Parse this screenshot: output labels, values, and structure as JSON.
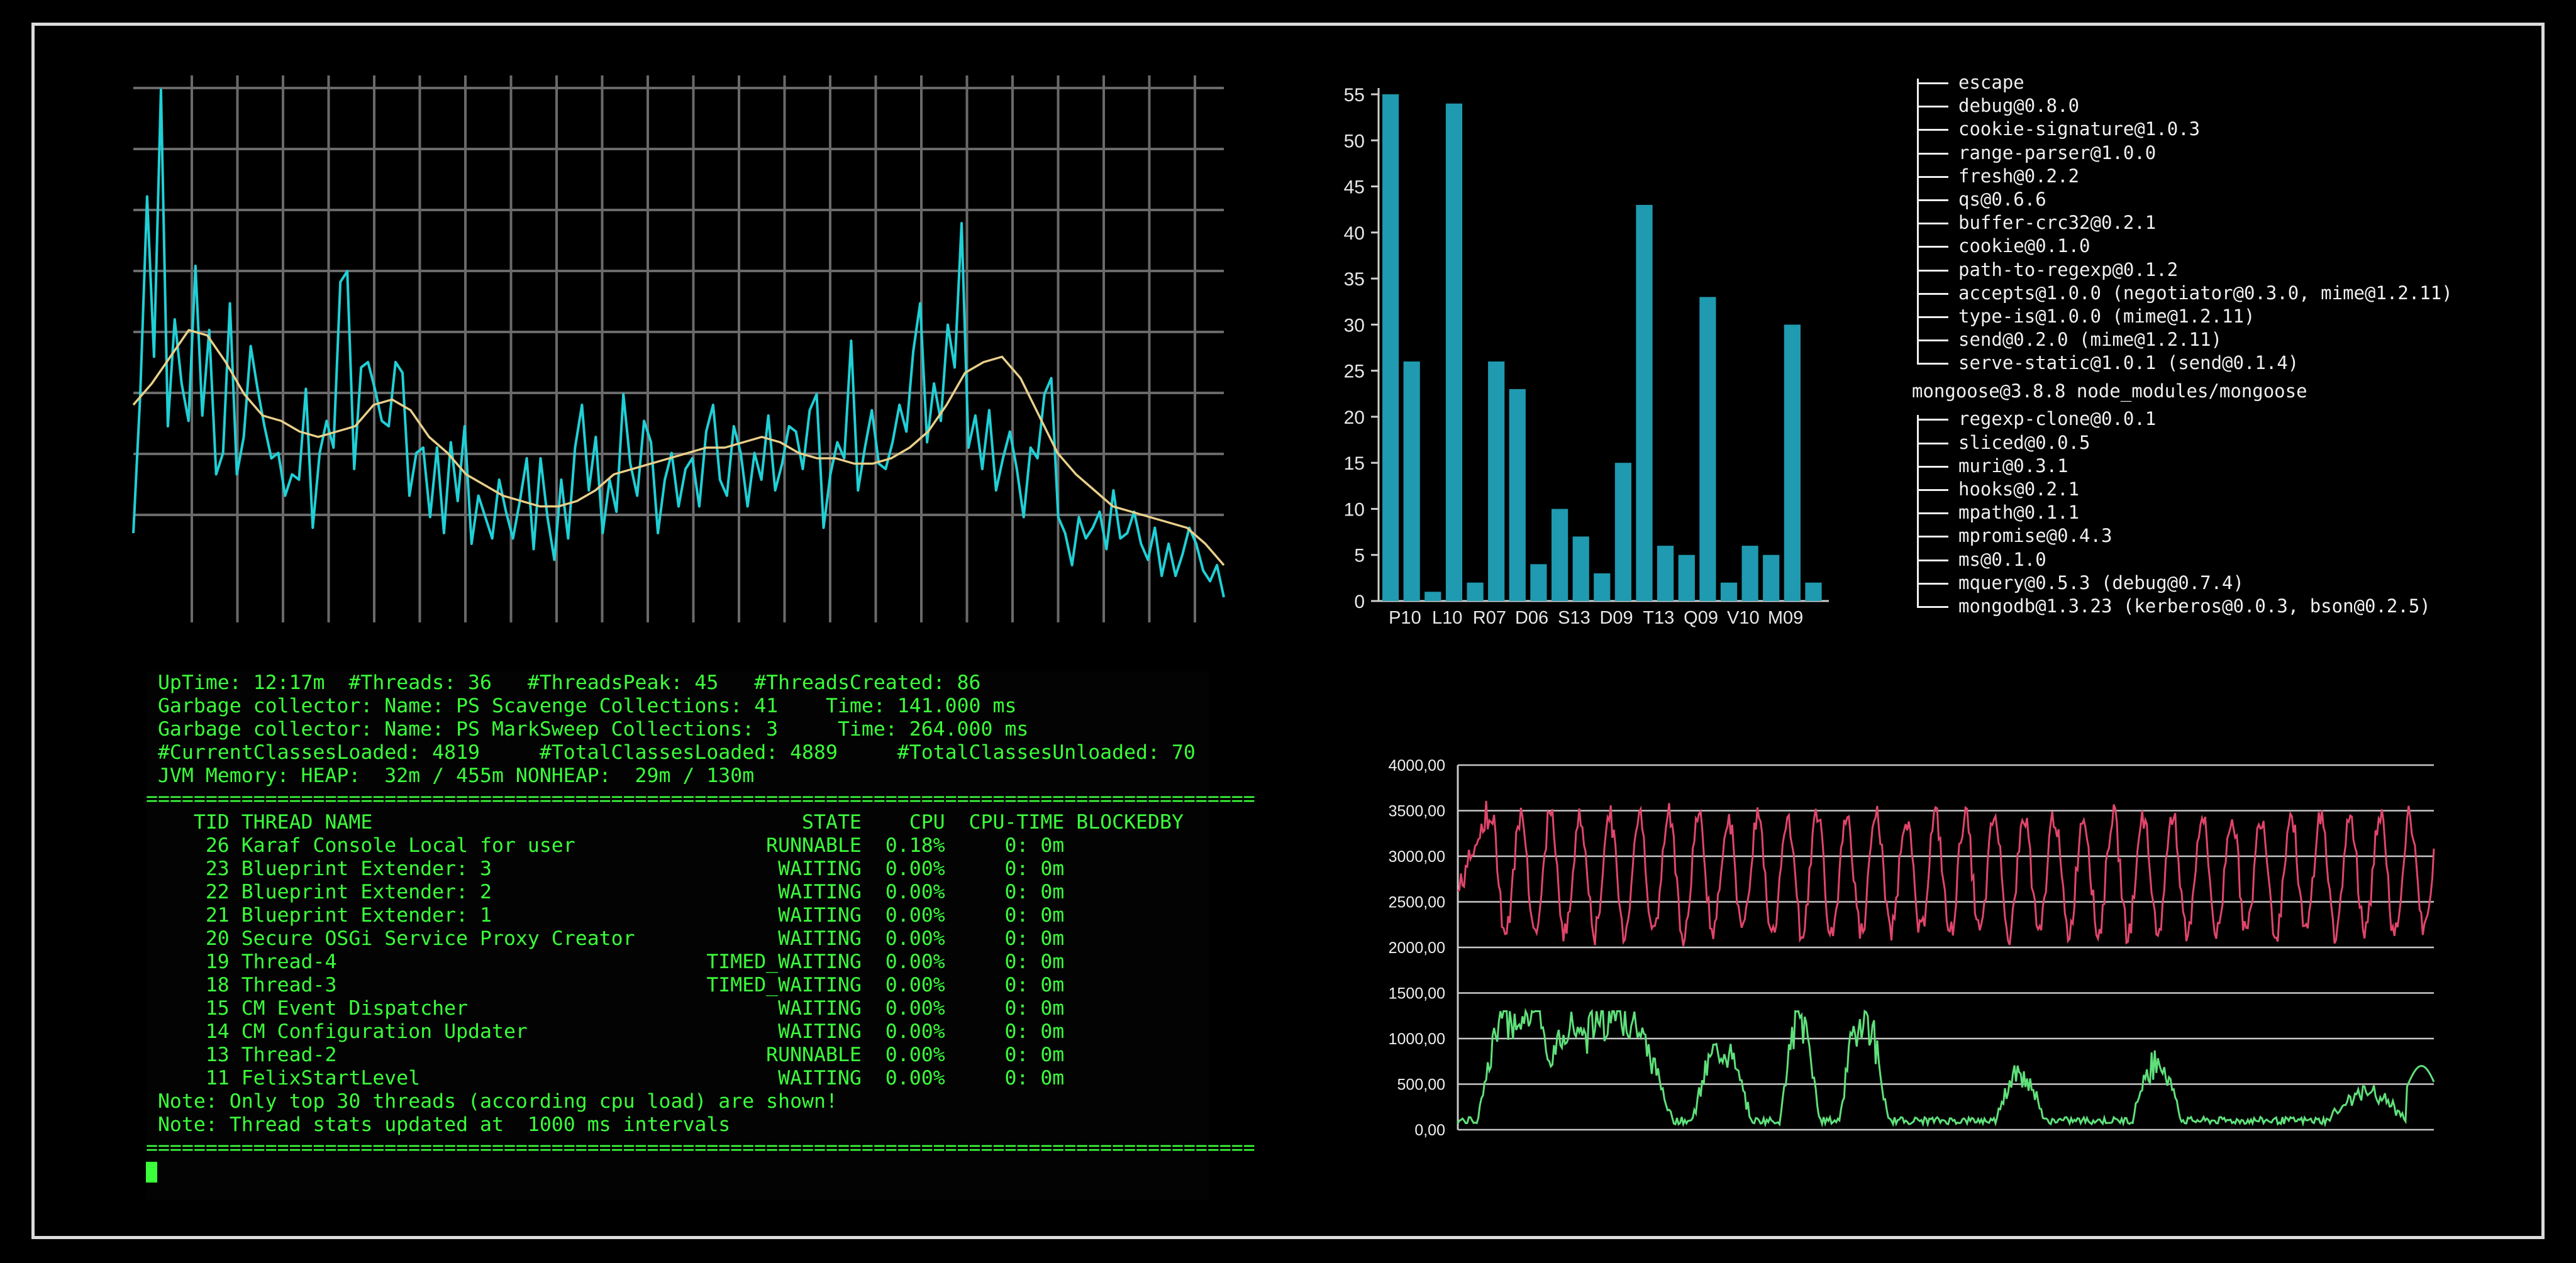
{
  "line_chart": {
    "colors": {
      "raw": "#1fd0d6",
      "smooth": "#e8cf8a",
      "grid": "#6a6a6a"
    },
    "raw": [
      0.12,
      0.38,
      0.75,
      0.45,
      0.95,
      0.32,
      0.52,
      0.4,
      0.33,
      0.62,
      0.34,
      0.5,
      0.23,
      0.27,
      0.55,
      0.23,
      0.3,
      0.47,
      0.39,
      0.32,
      0.26,
      0.27,
      0.19,
      0.23,
      0.22,
      0.39,
      0.13,
      0.27,
      0.33,
      0.28,
      0.59,
      0.61,
      0.24,
      0.43,
      0.44,
      0.39,
      0.33,
      0.32,
      0.44,
      0.42,
      0.19,
      0.27,
      0.28,
      0.15,
      0.28,
      0.12,
      0.29,
      0.18,
      0.32,
      0.1,
      0.19,
      0.15,
      0.11,
      0.22,
      0.16,
      0.11,
      0.18,
      0.26,
      0.09,
      0.26,
      0.15,
      0.07,
      0.22,
      0.11,
      0.28,
      0.36,
      0.2,
      0.3,
      0.12,
      0.22,
      0.16,
      0.38,
      0.25,
      0.19,
      0.33,
      0.29,
      0.12,
      0.22,
      0.27,
      0.17,
      0.24,
      0.26,
      0.17,
      0.31,
      0.36,
      0.22,
      0.19,
      0.32,
      0.27,
      0.17,
      0.27,
      0.22,
      0.34,
      0.2,
      0.25,
      0.32,
      0.31,
      0.24,
      0.35,
      0.38,
      0.13,
      0.23,
      0.29,
      0.26,
      0.48,
      0.2,
      0.28,
      0.35,
      0.25,
      0.24,
      0.29,
      0.36,
      0.31,
      0.46,
      0.55,
      0.29,
      0.4,
      0.33,
      0.51,
      0.43,
      0.7,
      0.28,
      0.34,
      0.24,
      0.35,
      0.2,
      0.26,
      0.31,
      0.24,
      0.15,
      0.28,
      0.26,
      0.38,
      0.41,
      0.15,
      0.12,
      0.06,
      0.15,
      0.11,
      0.13,
      0.16,
      0.09,
      0.2,
      0.11,
      0.12,
      0.16,
      0.1,
      0.07,
      0.13,
      0.04,
      0.1,
      0.04,
      0.08,
      0.13,
      0.1,
      0.05,
      0.03,
      0.06,
      0.0
    ],
    "smooth": [
      0.36,
      0.4,
      0.45,
      0.5,
      0.49,
      0.44,
      0.38,
      0.34,
      0.33,
      0.31,
      0.3,
      0.31,
      0.32,
      0.36,
      0.37,
      0.35,
      0.3,
      0.27,
      0.23,
      0.21,
      0.19,
      0.18,
      0.17,
      0.17,
      0.18,
      0.2,
      0.23,
      0.24,
      0.25,
      0.26,
      0.27,
      0.28,
      0.28,
      0.29,
      0.3,
      0.29,
      0.27,
      0.26,
      0.26,
      0.25,
      0.25,
      0.26,
      0.28,
      0.31,
      0.36,
      0.42,
      0.44,
      0.45,
      0.41,
      0.34,
      0.27,
      0.23,
      0.2,
      0.17,
      0.16,
      0.15,
      0.14,
      0.13,
      0.1,
      0.06
    ]
  },
  "bar_chart": {
    "color": "#1f9ab0",
    "axis_color": "#cfcfcf",
    "y_ticks": [
      "55",
      "50",
      "45",
      "40",
      "35",
      "30",
      "25",
      "20",
      "15",
      "10",
      "5",
      "0"
    ],
    "x_labels": [
      "P10",
      "L10",
      "R07",
      "D06",
      "S13",
      "D09",
      "T13",
      "Q09",
      "V10",
      "M09"
    ],
    "values": [
      55,
      26,
      1,
      54,
      2,
      26,
      23,
      4,
      10,
      7,
      3,
      15,
      43,
      6,
      5,
      33,
      2,
      6,
      5,
      30,
      2
    ]
  },
  "tree": {
    "group1": [
      "escape",
      "debug@0.8.0",
      "cookie-signature@1.0.3",
      "range-parser@1.0.0",
      "fresh@0.2.2",
      "qs@0.6.6",
      "buffer-crc32@0.2.1",
      "cookie@0.1.0",
      "path-to-regexp@0.1.2",
      "accepts@1.0.0 (negotiator@0.3.0, mime@1.2.11)",
      "type-is@1.0.0 (mime@1.2.11)",
      "send@0.2.0 (mime@1.2.11)",
      "serve-static@1.0.1 (send@0.1.4)"
    ],
    "root2": "mongoose@3.8.8 node_modules/mongoose",
    "group2": [
      "regexp-clone@0.0.1",
      "sliced@0.0.5",
      "muri@0.3.1",
      "hooks@0.2.1",
      "mpath@0.1.1",
      "mpromise@0.4.3",
      "ms@0.1.0",
      "mquery@0.5.3 (debug@0.7.4)",
      "mongodb@1.3.23 (kerberos@0.0.3, bson@0.2.5)"
    ]
  },
  "terminal": {
    "header": [
      " UpTime: 12:17m  #Threads: 36   #ThreadsPeak: 45   #ThreadsCreated: 86",
      " Garbage collector: Name: PS Scavenge Collections: 41    Time: 141.000 ms",
      " Garbage collector: Name: PS MarkSweep Collections: 3     Time: 264.000 ms",
      " #CurrentClassesLoaded: 4819     #TotalClassesLoaded: 4889     #TotalClassesUnloaded: 70",
      " JVM Memory: HEAP:  32m / 455m NONHEAP:  29m / 130m"
    ],
    "separator": "=============================================================================================",
    "table_header": "    TID THREAD NAME                                    STATE    CPU  CPU-TIME BLOCKEDBY",
    "rows": [
      "     26 Karaf Console Local for user                RUNNABLE  0.18%     0: 0m",
      "     23 Blueprint Extender: 3                        WAITING  0.00%     0: 0m",
      "     22 Blueprint Extender: 2                        WAITING  0.00%     0: 0m",
      "     21 Blueprint Extender: 1                        WAITING  0.00%     0: 0m",
      "     20 Secure OSGi Service Proxy Creator            WAITING  0.00%     0: 0m",
      "     19 Thread-4                               TIMED_WAITING  0.00%     0: 0m",
      "     18 Thread-3                               TIMED_WAITING  0.00%     0: 0m",
      "     15 CM Event Dispatcher                          WAITING  0.00%     0: 0m",
      "     14 CM Configuration Updater                     WAITING  0.00%     0: 0m",
      "     13 Thread-2                                    RUNNABLE  0.00%     0: 0m",
      "     11 FelixStartLevel                              WAITING  0.00%     0: 0m"
    ],
    "notes": [
      " Note: Only top 30 threads (according cpu load) are shown!",
      " Note: Thread stats updated at  1000 ms intervals"
    ]
  },
  "dual_chart": {
    "y_ticks": [
      "4000,00",
      "3500,00",
      "3000,00",
      "2500,00",
      "2000,00",
      "1500,00",
      "1000,00",
      "500,00",
      "0,00"
    ],
    "ylim": [
      0,
      4000
    ],
    "colors": {
      "top": "#e0456a",
      "bottom": "#5fe07a",
      "grid": "#c8c8c8",
      "label": "#f0f0f0"
    },
    "top_start": 2600,
    "bottom_start": 1050
  }
}
